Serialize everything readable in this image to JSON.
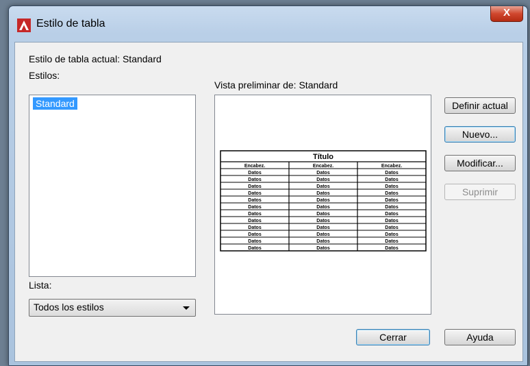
{
  "window": {
    "title": "Estilo de tabla",
    "close_label": "X"
  },
  "current_style": {
    "label": "Estilo de tabla actual: Standard"
  },
  "styles": {
    "label": "Estilos:",
    "items": [
      "Standard"
    ],
    "selected": "Standard"
  },
  "list_filter": {
    "label": "Lista:",
    "value": "Todos los estilos"
  },
  "preview": {
    "label": "Vista preliminar de: Standard",
    "table_title": "Título",
    "headers": [
      "Encabez.",
      "Encabez.",
      "Encabez."
    ],
    "rows": [
      [
        "Datos",
        "Datos",
        "Datos"
      ],
      [
        "Datos",
        "Datos",
        "Datos"
      ],
      [
        "Datos",
        "Datos",
        "Datos"
      ],
      [
        "Datos",
        "Datos",
        "Datos"
      ],
      [
        "Datos",
        "Datos",
        "Datos"
      ],
      [
        "Datos",
        "Datos",
        "Datos"
      ],
      [
        "Datos",
        "Datos",
        "Datos"
      ],
      [
        "Datos",
        "Datos",
        "Datos"
      ],
      [
        "Datos",
        "Datos",
        "Datos"
      ],
      [
        "Datos",
        "Datos",
        "Datos"
      ],
      [
        "Datos",
        "Datos",
        "Datos"
      ],
      [
        "Datos",
        "Datos",
        "Datos"
      ]
    ]
  },
  "buttons": {
    "set_current": "Definir actual",
    "new": "Nuevo...",
    "modify": "Modificar...",
    "delete": "Suprimir",
    "close": "Cerrar",
    "help": "Ayuda"
  },
  "colors": {
    "selection": "#3399ff",
    "app_icon": "#d32f2f"
  }
}
